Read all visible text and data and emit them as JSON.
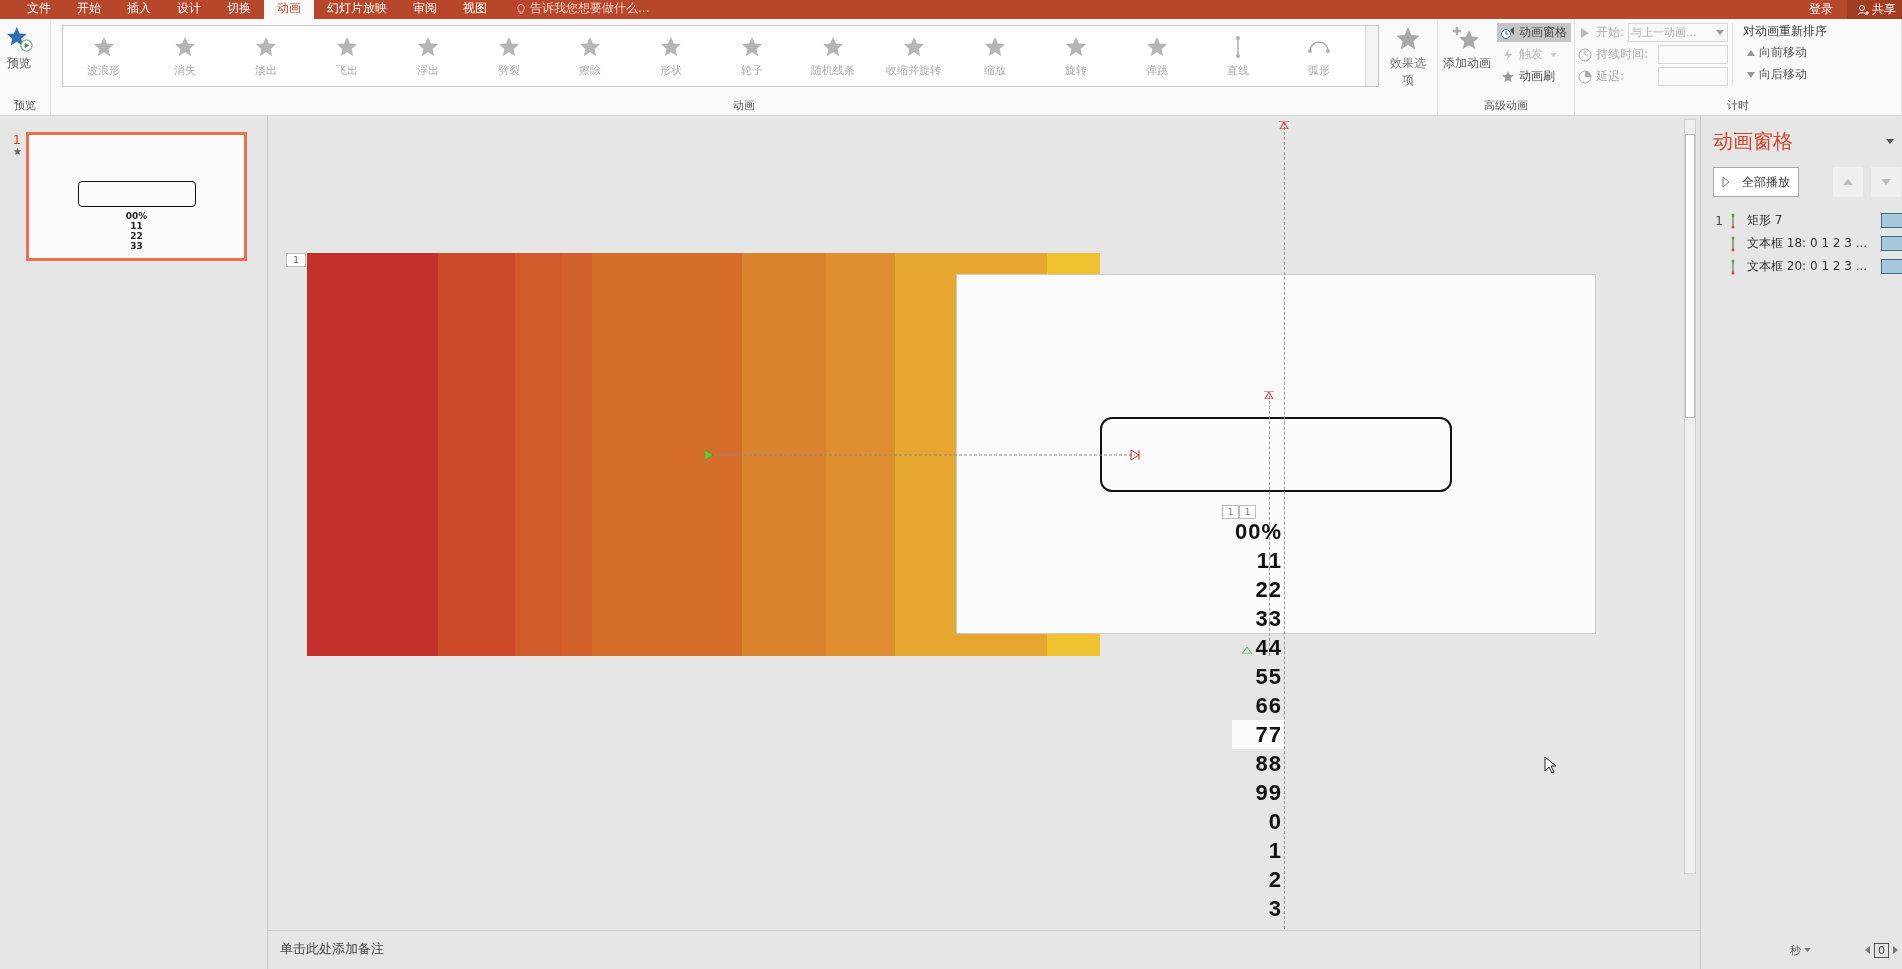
{
  "tabs": [
    {
      "label": "文件",
      "selected": false
    },
    {
      "label": "开始",
      "selected": false
    },
    {
      "label": "插入",
      "selected": false
    },
    {
      "label": "设计",
      "selected": false
    },
    {
      "label": "切换",
      "selected": false
    },
    {
      "label": "动画",
      "selected": true
    },
    {
      "label": "幻灯片放映",
      "selected": false
    },
    {
      "label": "审阅",
      "selected": false
    },
    {
      "label": "视图",
      "selected": false
    }
  ],
  "tell_me": "告诉我您想要做什么...",
  "account": {
    "sign_in": "登录",
    "share": "共享"
  },
  "ribbon": {
    "preview": {
      "label": "预览",
      "group": "预览"
    },
    "gallery": {
      "group": "动画",
      "items": [
        {
          "label": "波浪形",
          "kind": "star"
        },
        {
          "label": "消失",
          "kind": "star"
        },
        {
          "label": "淡出",
          "kind": "star"
        },
        {
          "label": "飞出",
          "kind": "star"
        },
        {
          "label": "浮出",
          "kind": "star"
        },
        {
          "label": "劈裂",
          "kind": "star"
        },
        {
          "label": "擦除",
          "kind": "star"
        },
        {
          "label": "形状",
          "kind": "star"
        },
        {
          "label": "轮子",
          "kind": "star"
        },
        {
          "label": "随机线条",
          "kind": "star"
        },
        {
          "label": "收缩并旋转",
          "kind": "star"
        },
        {
          "label": "缩放",
          "kind": "star"
        },
        {
          "label": "旋转",
          "kind": "star"
        },
        {
          "label": "弹跳",
          "kind": "star"
        },
        {
          "label": "直线",
          "kind": "line"
        },
        {
          "label": "弧形",
          "kind": "arc"
        }
      ]
    },
    "effect_options": "效果选项",
    "advanced": {
      "add": "添加动画",
      "pane": {
        "label": "动画窗格",
        "selected": true
      },
      "trigger": "触发",
      "painter": "动画刷",
      "group": "高级动画"
    },
    "timing": {
      "start_label": "开始:",
      "start_value": "与上一动画...",
      "duration_label": "持续时间:",
      "delay_label": "延迟:",
      "group": "计时"
    },
    "reorder": {
      "title": "对动画重新排序",
      "forward": "向前移动",
      "backward": "向后移动"
    }
  },
  "thumbnails": [
    {
      "number": "1",
      "selected": true,
      "preview_lines": [
        "00%",
        "11",
        "22",
        "33"
      ]
    }
  ],
  "slide": {
    "tag": "1",
    "box_tags": [
      "1",
      "1"
    ],
    "digits": [
      {
        "text": "00%",
        "highlighted": false
      },
      {
        "text": "11",
        "highlighted": false
      },
      {
        "text": "22",
        "highlighted": false
      },
      {
        "text": "33",
        "highlighted": false
      },
      {
        "text": "44",
        "highlighted": false
      },
      {
        "text": "55",
        "highlighted": false
      },
      {
        "text": "66",
        "highlighted": false
      },
      {
        "text": "77",
        "highlighted": true
      },
      {
        "text": "88",
        "highlighted": false
      },
      {
        "text": "99",
        "highlighted": false
      },
      {
        "text": "0",
        "highlighted": false
      },
      {
        "text": "1",
        "highlighted": false
      },
      {
        "text": "2",
        "highlighted": false
      },
      {
        "text": "3",
        "highlighted": false
      }
    ]
  },
  "notes_placeholder": "单击此处添加备注",
  "animation_pane": {
    "title": "动画窗格",
    "play_all": "全部播放",
    "items": [
      {
        "number": "1",
        "name": "矩形 7"
      },
      {
        "name": "文本框 18: 0 1 2 3 ..."
      },
      {
        "name": "文本框 20: 0 1 2 3 ..."
      }
    ]
  },
  "status": {
    "unit": "秒",
    "zoom_value": "0"
  }
}
